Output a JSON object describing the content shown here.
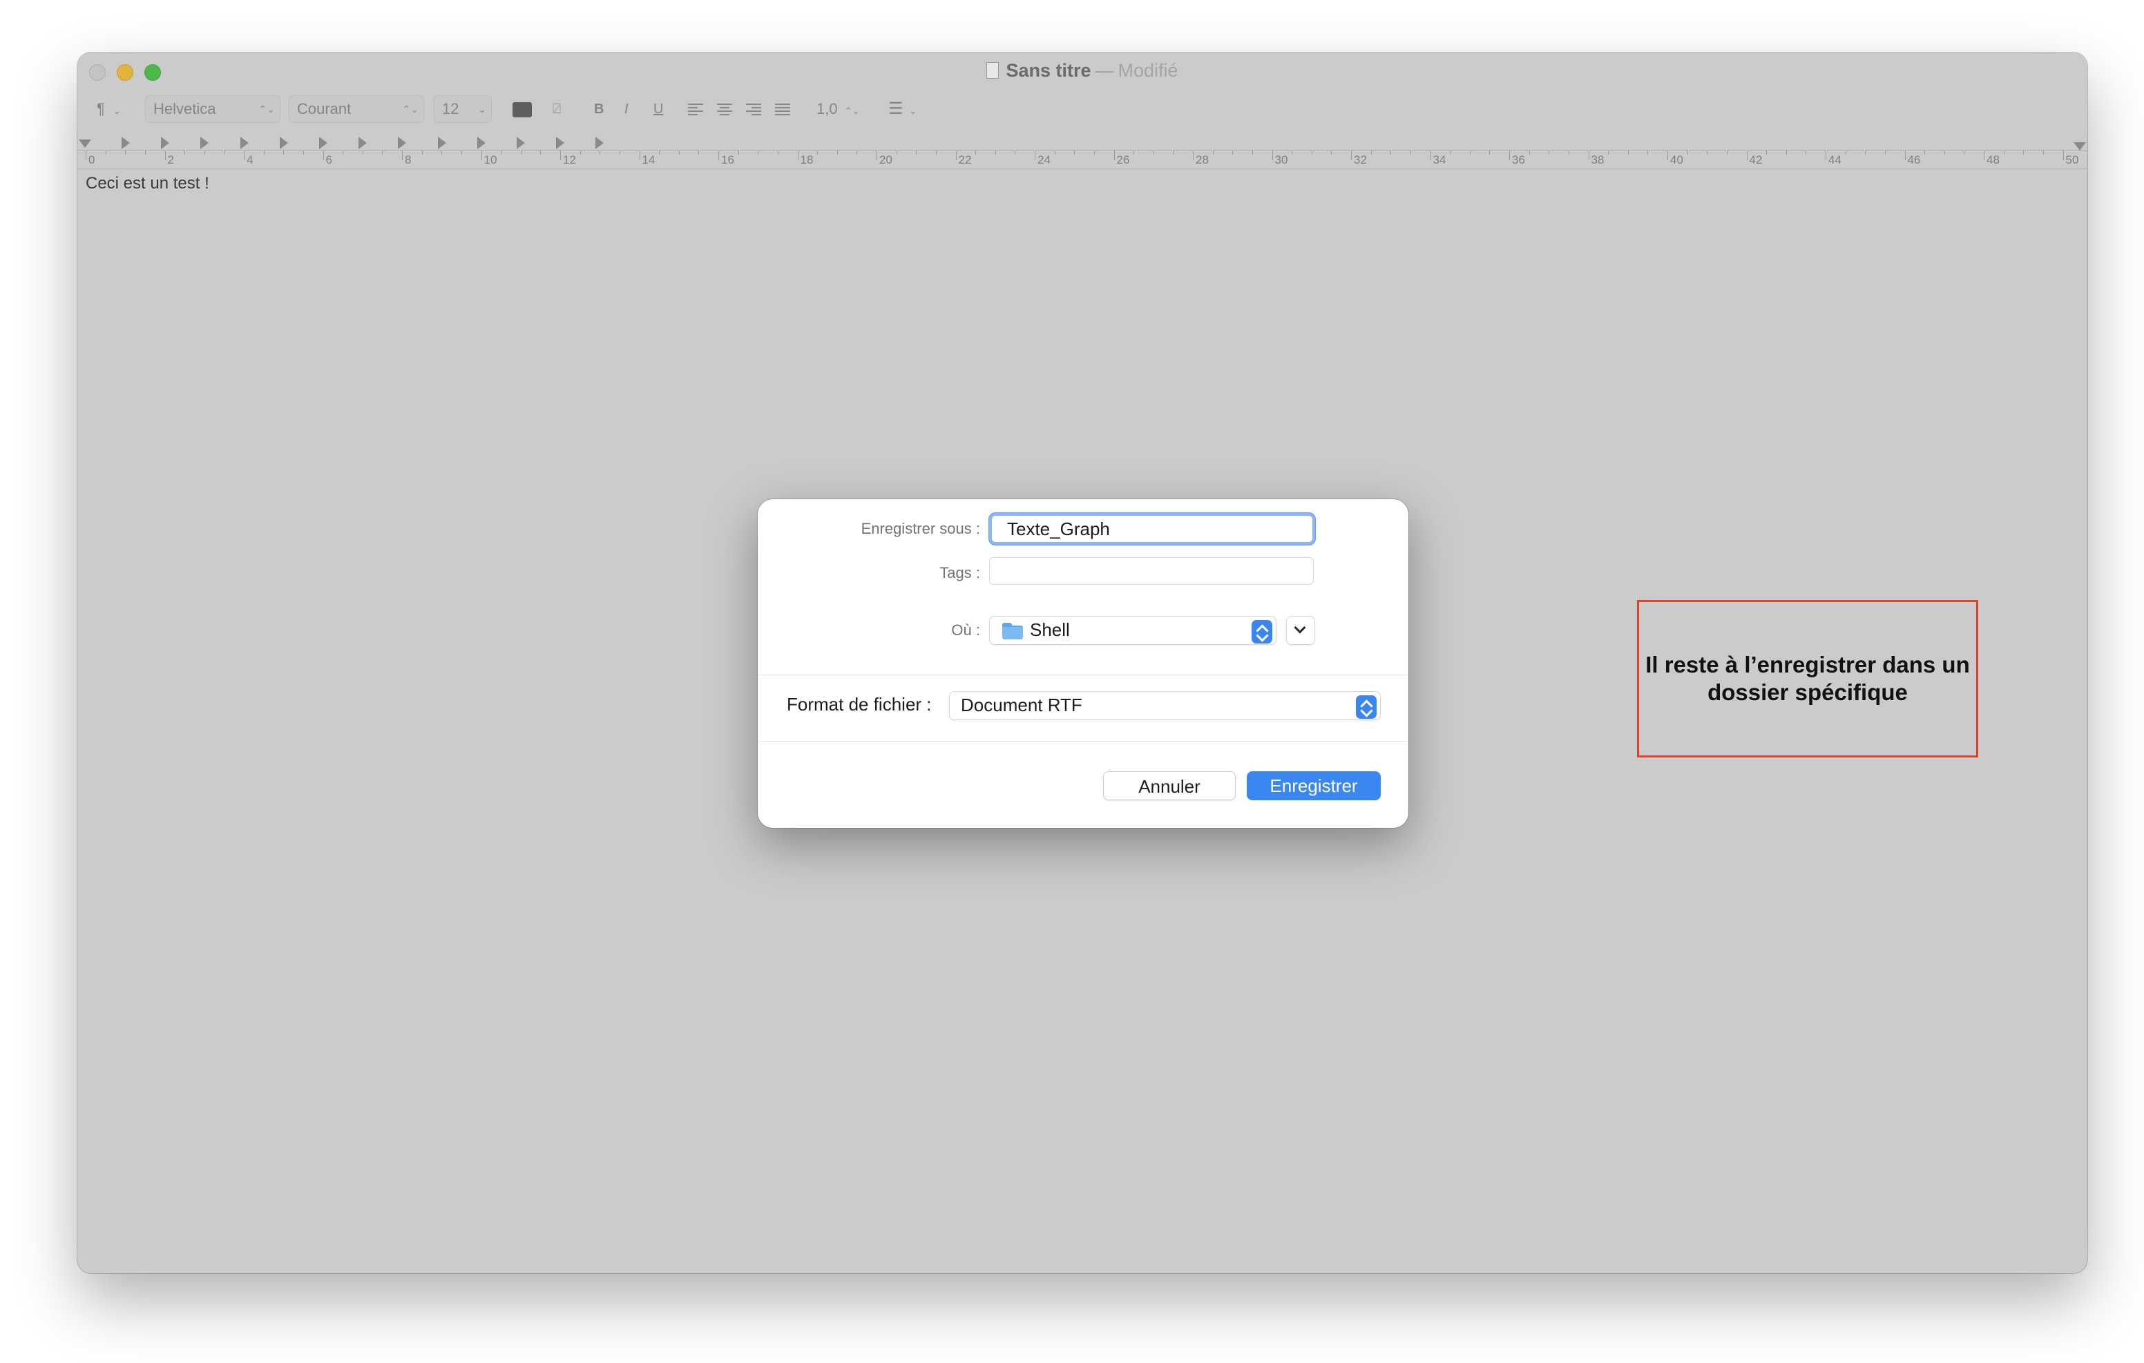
{
  "window": {
    "title": "Sans titre",
    "title_separator": "—",
    "title_state": "Modifié"
  },
  "toolbar": {
    "paragraph_symbol": "¶",
    "font_family": "Helvetica",
    "font_style": "Courant",
    "font_size": "12",
    "bold": "B",
    "italic": "I",
    "underline": "U",
    "line_spacing": "1,0",
    "text_color_swatch": "#5e5e5e"
  },
  "ruler": {
    "labels": [
      "0",
      "2",
      "4",
      "6",
      "8",
      "10",
      "12",
      "14",
      "16",
      "18",
      "20",
      "22",
      "24",
      "26",
      "28",
      "30",
      "32",
      "34",
      "36",
      "38",
      "40",
      "42",
      "44",
      "46",
      "48",
      "50"
    ]
  },
  "document": {
    "text": "Ceci est un test !"
  },
  "dialog": {
    "save_as_label": "Enregistrer sous :",
    "save_as_value": "Texte_Graph",
    "tags_label": "Tags :",
    "tags_value": "",
    "where_label": "Où :",
    "where_value": "Shell",
    "format_label": "Format de fichier :",
    "format_value": "Document RTF",
    "cancel_label": "Annuler",
    "save_label": "Enregistrer",
    "accent_color": "#3b87f2"
  },
  "annotation": {
    "text": "Il reste à l’enregistrer dans un dossier spécifique",
    "border_color": "#e0452b"
  }
}
